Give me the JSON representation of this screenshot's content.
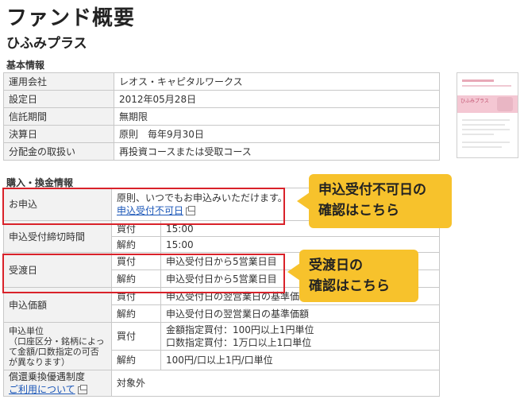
{
  "page": {
    "title": "ファンド概要",
    "fund_name": "ひふみプラス"
  },
  "basic": {
    "heading": "基本情報",
    "rows": [
      {
        "label": "運用会社",
        "value": "レオス・キャピタルワークス"
      },
      {
        "label": "設定日",
        "value": "2012年05月28日"
      },
      {
        "label": "信託期間",
        "value": "無期限"
      },
      {
        "label": "決算日",
        "value": "原則　毎年9月30日"
      },
      {
        "label": "分配金の取扱い",
        "value": "再投資コースまたは受取コース"
      }
    ]
  },
  "thumbnail": {
    "title": "ひふみプラス"
  },
  "purchase": {
    "heading": "購入・換金情報",
    "apply": {
      "label": "お申込",
      "text": "原則、いつでもお申込みいただけます。",
      "link": "申込受付不可日"
    },
    "cutoff": {
      "label": "申込受付締切時間",
      "buy": "買付",
      "buy_val": "15:00",
      "sell": "解約",
      "sell_val": "15:00"
    },
    "delivery": {
      "label": "受渡日",
      "buy": "買付",
      "buy_val": "申込受付日から5営業日目",
      "sell": "解約",
      "sell_val": "申込受付日から5営業日目"
    },
    "price": {
      "label": "申込価額",
      "buy": "買付",
      "buy_val": "申込受付日の翌営業日の基準価額",
      "sell": "解約",
      "sell_val": "申込受付日の翌営業日の基準価額"
    },
    "unit": {
      "label": "申込単位\n（口座区分・銘柄によって金額/口数指定の可否が異なります）",
      "buy": "買付",
      "buy_val_1": "金額指定買付：100円以上1円単位",
      "buy_val_2": "口数指定買付：1万口以上1口単位",
      "sell": "解約",
      "sell_val": "100円/口以上1円/口単位"
    },
    "priority": {
      "label": "償還乗換優遇制度",
      "link": "ご利用について",
      "value": "対象外"
    }
  },
  "callouts": {
    "non_acceptance": "申込受付不可日の\n確認はこちら",
    "delivery": "受渡日の\n確認はこちら"
  },
  "colors": {
    "highlight_border": "#d9222a",
    "callout_bg": "#f7c22c",
    "link": "#1a56b8",
    "label_bg": "#f2f2f2"
  }
}
